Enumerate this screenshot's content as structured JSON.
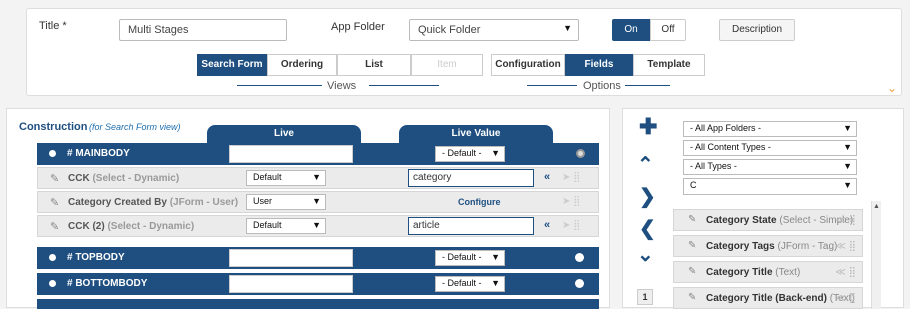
{
  "top": {
    "title_label": "Title *",
    "title_value": "Multi Stages",
    "app_folder_label": "App Folder",
    "app_folder_value": "Quick Folder",
    "toggle_on": "On",
    "toggle_off": "Off",
    "description_button": "Description",
    "views_tabs": [
      "Search Form",
      "Ordering",
      "List",
      "Item"
    ],
    "views_caption": "Views",
    "options_tabs": [
      "Configuration",
      "Fields",
      "Template"
    ],
    "options_caption": "Options"
  },
  "construction": {
    "heading": "Construction",
    "subheading": "(for Search Form view)",
    "col_live": "Live",
    "col_live_value": "Live Value",
    "rows": [
      {
        "title": "# MAINBODY",
        "select": "- Default -"
      },
      {
        "title": "CCK",
        "subtitle": "(Select - Dynamic)",
        "live": "Default",
        "value": "category",
        "chev": "«"
      },
      {
        "title": "Category Created By",
        "subtitle": "(JForm - User)",
        "live": "User",
        "value": "Configure"
      },
      {
        "title": "CCK (2)",
        "subtitle": "(Select - Dynamic)",
        "live": "Default",
        "value": "article",
        "chev": "«"
      },
      {
        "title": "# TOPBODY",
        "select": "- Default -"
      },
      {
        "title": "# BOTTOMBODY",
        "select": "- Default -"
      }
    ]
  },
  "filters": {
    "app_folders": "- All App Folders -",
    "content_types": "- All Content Types -",
    "types": "- All Types -",
    "search": "C"
  },
  "fields_list": [
    {
      "name": "Category State",
      "type": "(Select - Simple)"
    },
    {
      "name": "Category Tags",
      "type": "(JForm - Tag)"
    },
    {
      "name": "Category Title",
      "type": "(Text)"
    },
    {
      "name": "Category Title (Back-end)",
      "type": "(Text)"
    }
  ],
  "page_indicator": "1"
}
